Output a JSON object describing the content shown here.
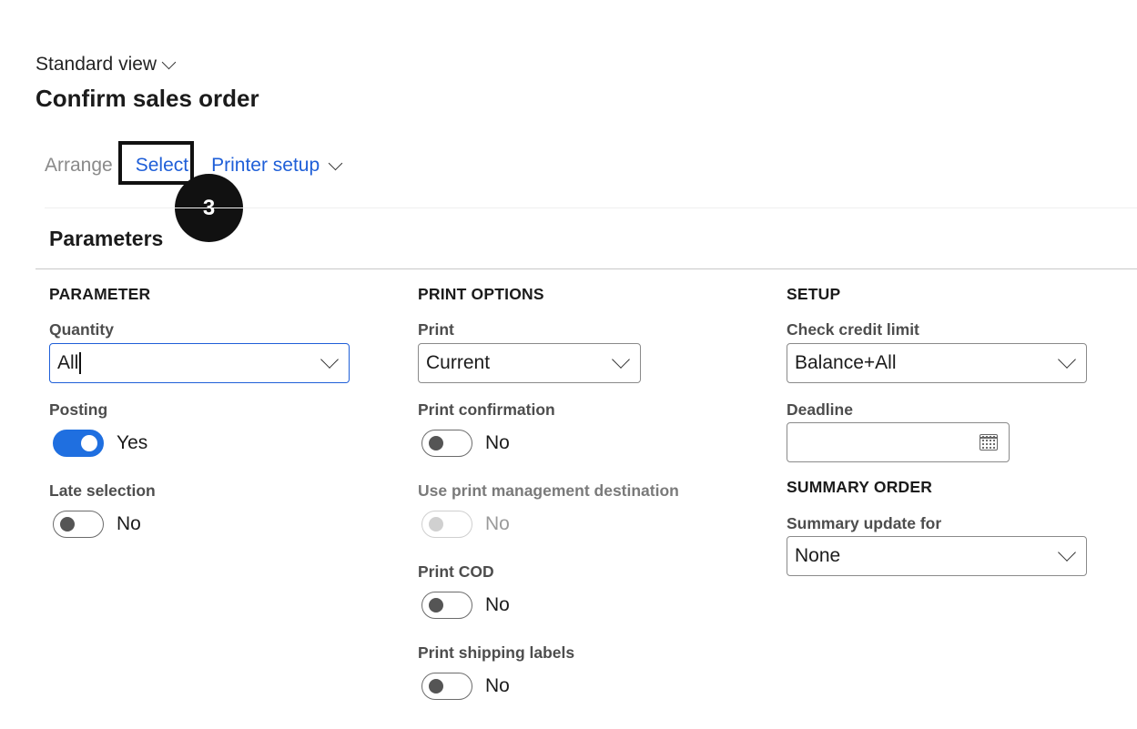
{
  "header": {
    "view_label": "Standard view",
    "title": "Confirm sales order"
  },
  "toolbar": {
    "arrange": "Arrange",
    "select": "Select",
    "printer_setup": "Printer setup"
  },
  "annotation": {
    "step_number": "3"
  },
  "section": {
    "title": "Parameters"
  },
  "parameter": {
    "heading": "PARAMETER",
    "quantity_label": "Quantity",
    "quantity_value": "All",
    "posting_label": "Posting",
    "posting_value": "Yes",
    "late_selection_label": "Late selection",
    "late_selection_value": "No"
  },
  "print_options": {
    "heading": "PRINT OPTIONS",
    "print_label": "Print",
    "print_value": "Current",
    "print_confirmation_label": "Print confirmation",
    "print_confirmation_value": "No",
    "use_print_mgmt_label": "Use print management destination",
    "use_print_mgmt_value": "No",
    "print_cod_label": "Print COD",
    "print_cod_value": "No",
    "print_shipping_labels_label": "Print shipping labels",
    "print_shipping_labels_value": "No"
  },
  "setup": {
    "heading": "SETUP",
    "check_credit_limit_label": "Check credit limit",
    "check_credit_limit_value": "Balance+All",
    "deadline_label": "Deadline",
    "deadline_value": ""
  },
  "summary_order": {
    "heading": "SUMMARY ORDER",
    "summary_update_label": "Summary update for",
    "summary_update_value": "None"
  },
  "colors": {
    "accent": "#1f5fd8",
    "toggle_on": "#1f6fe0",
    "annotation": "#111111"
  }
}
